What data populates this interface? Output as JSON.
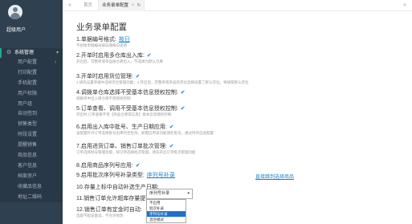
{
  "user": {
    "name": "超级用户"
  },
  "sidebar": {
    "section": {
      "label": "系统管理"
    },
    "items": [
      {
        "label": "用户配置",
        "has_caret": true
      },
      {
        "label": "打印配置",
        "has_caret": false
      },
      {
        "label": "手机配置",
        "has_caret": false
      },
      {
        "label": "用户权限",
        "has_caret": false
      },
      {
        "label": "用户组",
        "has_caret": false
      },
      {
        "label": "自动签到",
        "has_caret": false
      },
      {
        "label": "销售类型",
        "has_caret": false
      },
      {
        "label": "时段设置",
        "has_caret": false
      },
      {
        "label": "提醒销售",
        "has_caret": false
      },
      {
        "label": "商品信息",
        "has_caret": false
      },
      {
        "label": "客户信息",
        "has_caret": false
      },
      {
        "label": "档案资户",
        "has_caret": false
      },
      {
        "label": "收藏品信息",
        "has_caret": false
      },
      {
        "label": "地址二维码",
        "has_caret": false
      }
    ]
  },
  "topbar": {
    "nav_back": "«",
    "nav_forward": "»",
    "tabs": [
      {
        "label": "首页",
        "active": false
      },
      {
        "label": "业务录单配置",
        "active": true
      }
    ]
  },
  "main": {
    "title": "业务录单配置",
    "settings": [
      {
        "label": "1.单据编号格式:",
        "value": "按日",
        "desc": "不初始单据编号按日期每日递增"
      },
      {
        "label": "2.开单时启用多仓库出入库:",
        "value": "✔",
        "desc": "开启后，可整单或单品按仓库出入，不选择为默认仓库"
      },
      {
        "label": "3.开单时启用货位管理:",
        "value": "✔",
        "desc": "1.请先设置单据中选择货位管理功能；2.开启后，若整单或单品的货位选择设置了默认货位，将按照默认货位"
      },
      {
        "label": "4.调拨单仓库选择不受基本信息授权控制:",
        "value": "✔",
        "desc": "调拨单中出入库仓库不受授权控制"
      },
      {
        "label": "5.订单查看、调用不受基本信息授权控制:",
        "value": "✔",
        "desc": "开启时,订单查看不受【商品仓库等信息】基本信息授权控制"
      },
      {
        "label": "6.启用出入库中批号、生产日期应用:",
        "value": "✔",
        "desc": "该配置针对订单选择批号出库时合生效，如需启用该功能请在批号，通过时开启此配置"
      },
      {
        "label": "7.启用进货订单、销售订单批次管理:",
        "value": "✔",
        "desc": "订单选择批号管理功能，如订单选择批次管理，请先开启订单批次管理功能"
      },
      {
        "label": "8.启用商品序列号应用:",
        "value": "✔",
        "desc": ""
      },
      {
        "label": "9.启用批次序列号补录类型:",
        "value": "序列号补录",
        "desc": ""
      },
      {
        "label": "10.存量上标中自动补选生产日期:",
        "value": "直接跳到选择商品",
        "desc": ""
      },
      {
        "label": "11.销售订单允许超库存量提取:",
        "value": "",
        "desc": ""
      },
      {
        "label": "12.销售订单有定金时自动:",
        "value": "",
        "desc": "选取不超该量设，不允许修改"
      }
    ],
    "dropdown": {
      "selected": "序列号补录",
      "options": [
        {
          "label": "不启用",
          "selected": false
        },
        {
          "label": "批次补录",
          "selected": false
        },
        {
          "label": "序列号补录",
          "selected": true
        },
        {
          "label": "混合模式",
          "selected": false
        }
      ]
    }
  },
  "colors": {
    "sidebar_bg": "#2f4050",
    "accent": "#19aa8d",
    "link": "#1c84c6",
    "selected_option": "#1e70d0"
  }
}
